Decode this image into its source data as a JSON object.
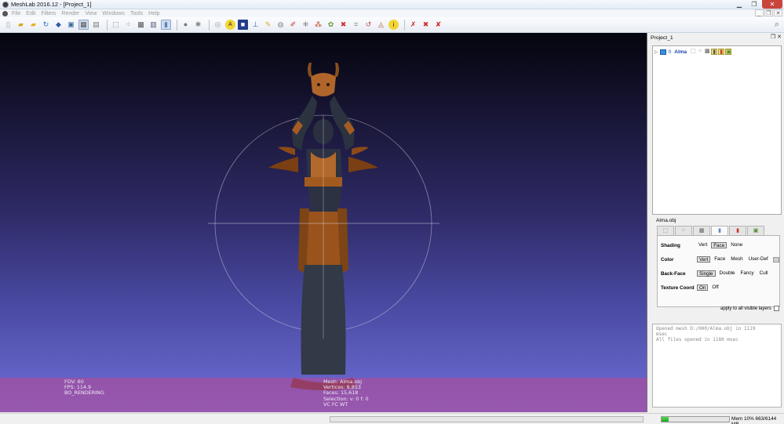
{
  "window": {
    "title": "MeshLab 2016.12 - [Project_1]"
  },
  "menu": [
    "File",
    "Edit",
    "Filters",
    "Render",
    "View",
    "Windows",
    "Tools",
    "Help"
  ],
  "toolbar": {
    "buttons": [
      "new-project-icon",
      "open-project-icon",
      "import-mesh-icon",
      "reload-icon",
      "export-mesh-icon",
      "snapshot-icon",
      "layer-icon",
      "box-icon",
      "points-icon",
      "wireframe-icon",
      "solid-icon",
      "flat-icon",
      "smooth-icon",
      "texture-icon",
      "light-icon",
      "trackball-icon",
      "info-icon",
      "annotate-icon",
      "pick-icon",
      "align-icon",
      "paint-icon",
      "select-icon",
      "measure-icon",
      "brush-icon",
      "sample-icon",
      "stats-icon",
      "zoom-icon",
      "rotate-icon",
      "close-tool-icon",
      "delete-icon",
      "remove-icon"
    ]
  },
  "viewport": {
    "fov": "FOV: 60",
    "fps": "FPS:   114.9",
    "mode": "BO_RENDERING",
    "mesh": "Mesh: Alma.obj",
    "vertices": "Vertices: 8,853",
    "faces": "Faces: 15,618",
    "selection": "Selection: v: 0 f: 0",
    "flags": "VC FC WT"
  },
  "dock": {
    "title": "Project_1",
    "layer": {
      "num": "0",
      "name": "Alma"
    },
    "mesh_file": "Alma.obj",
    "shading": {
      "label": "Shading",
      "options": [
        "Vert",
        "Face",
        "None"
      ],
      "selected": "Face"
    },
    "color": {
      "label": "Color",
      "options": [
        "Vert",
        "Face",
        "Mesh",
        "User-Def"
      ],
      "selected": "Vert"
    },
    "backface": {
      "label": "Back-Face",
      "options": [
        "Single",
        "Double",
        "Fancy",
        "Cull"
      ],
      "selected": "Single"
    },
    "texcoord": {
      "label": "Texture Coord",
      "options": [
        "On",
        "Off"
      ],
      "selected": "On"
    },
    "apply_all": "apply to all visible layers",
    "log": [
      "Opened mesh D:/000/Alma.obj in 1119",
      "msec",
      "All files opened in 1180 msec"
    ]
  },
  "status": {
    "memory": "Mem 10% 663/6144 MB",
    "memory_fraction": 0.108
  },
  "colors": {
    "viewport_top": "#05050e",
    "viewport_bottom": "#6f6fd8",
    "info_bar": "#b04a96",
    "accent": "#1a3fb0"
  }
}
